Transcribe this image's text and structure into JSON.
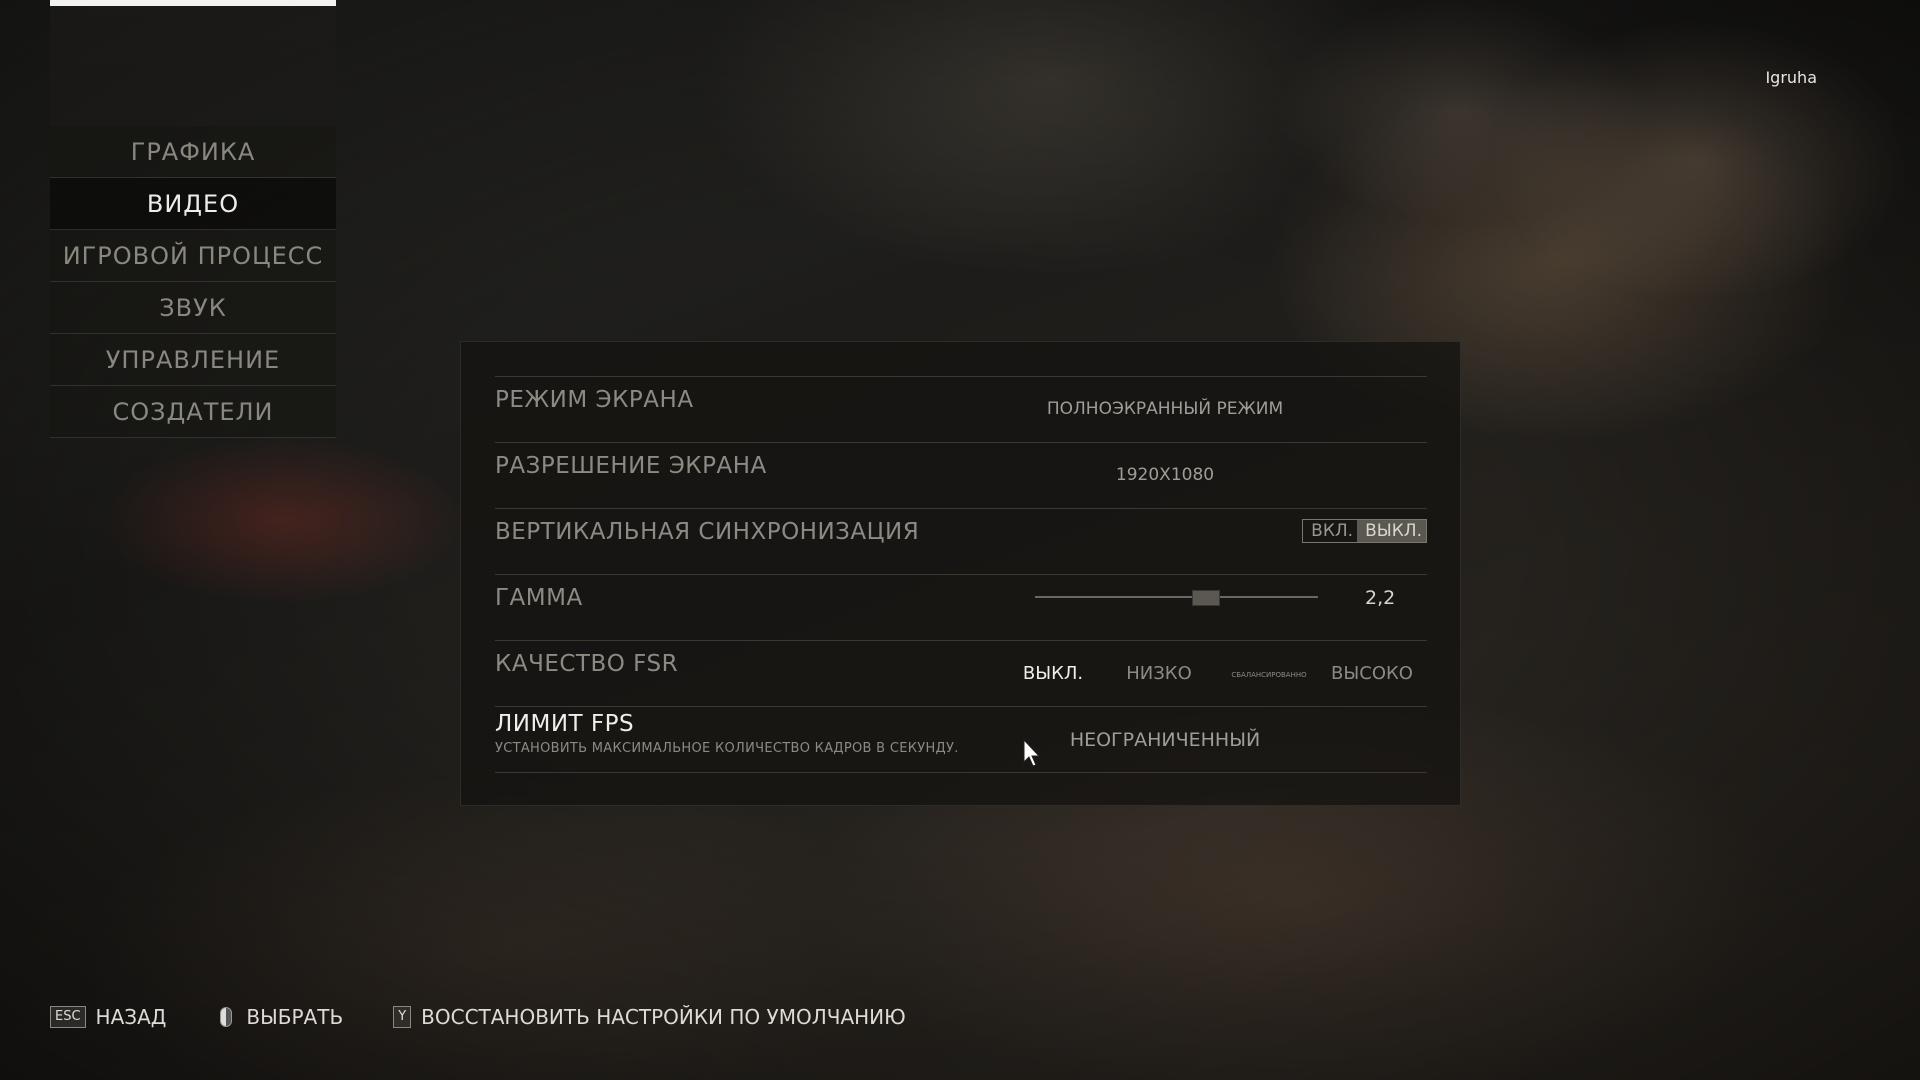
{
  "user": "Igruha",
  "sidebar": {
    "items": [
      {
        "label": "ГРАФИКА"
      },
      {
        "label": "ВИДЕО"
      },
      {
        "label": "ИГРОВОЙ ПРОЦЕСС"
      },
      {
        "label": "ЗВУК"
      },
      {
        "label": "УПРАВЛЕНИЕ"
      },
      {
        "label": "СОЗДАТЕЛИ"
      }
    ],
    "active": "ВИДЕО"
  },
  "settings": {
    "screen_mode": {
      "label": "РЕЖИМ ЭКРАНА",
      "value": "ПОЛНОЭКРАННЫЙ РЕЖИМ"
    },
    "resolution": {
      "label": "РАЗРЕШЕНИЕ ЭКРАНА",
      "value": "1920X1080"
    },
    "vsync": {
      "label": "ВЕРТИКАЛЬНАЯ СИНХРОНИЗАЦИЯ",
      "on": "ВКЛ.",
      "off": "ВЫКЛ.",
      "selected": "off"
    },
    "gamma": {
      "label": "ГАММА",
      "value": "2,2",
      "level": 0.6
    },
    "fsr": {
      "label": "КАЧЕСТВО FSR",
      "options": [
        "ВЫКЛ.",
        "НИЗКО",
        "СБАЛАНСИРОВАННО",
        "ВЫСОКО"
      ],
      "selected": "ВЫКЛ."
    },
    "fps_limit": {
      "label": "ЛИМИТ FPS",
      "description": "УСТАНОВИТЬ МАКСИМАЛЬНОЕ КОЛИЧЕСТВО КАДРОВ В СЕКУНДУ.",
      "value": "НЕОГРАНИЧЕННЫЙ"
    }
  },
  "hints": {
    "back_key": "ESC",
    "back_label": "НАЗАД",
    "select_label": "ВЫБРАТЬ",
    "reset_key": "Y",
    "reset_label": "ВОССТАНОВИТЬ НАСТРОЙКИ ПО УМОЛЧАНИЮ"
  }
}
